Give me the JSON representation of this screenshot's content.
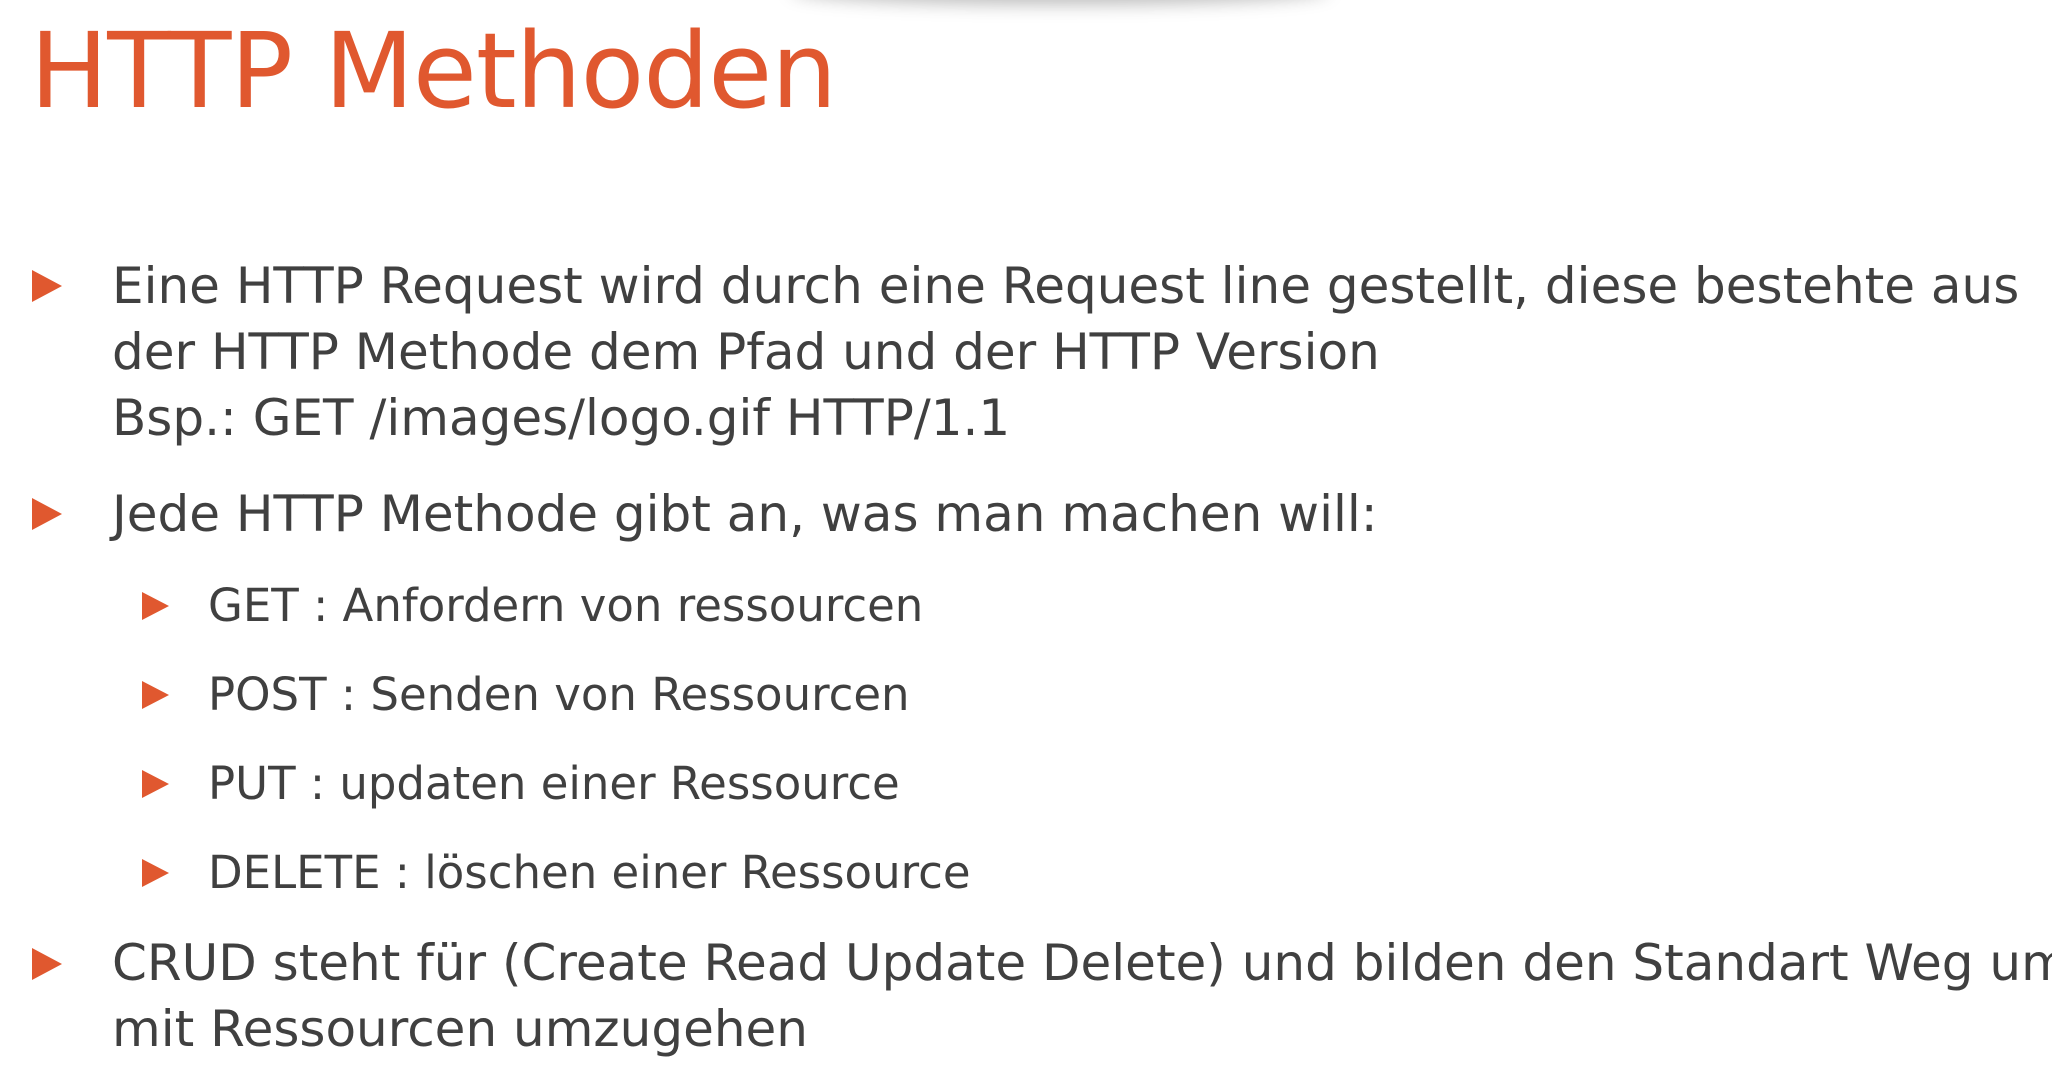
{
  "slide": {
    "title": "HTTP Methoden",
    "accent_color": "#e0582f",
    "text_color": "#404040",
    "bullet_marker_icon": "triangle-right-icon",
    "bullets": [
      {
        "lines": [
          "Eine HTTP Request wird durch eine Request line gestellt, diese bestehte aus",
          "der HTTP Methode dem Pfad und der HTTP Version",
          "Bsp.: GET /images/logo.gif HTTP/1.1"
        ]
      },
      {
        "lines": [
          "Jede HTTP Methode gibt an, was man machen will:"
        ],
        "sub_items": [
          "GET : Anfordern von ressourcen",
          "POST : Senden von Ressourcen",
          "PUT : updaten einer Ressource",
          "DELETE : löschen einer Ressource"
        ]
      },
      {
        "lines": [
          "CRUD steht für (Create Read Update Delete) und bilden den Standart Weg um",
          "mit Ressourcen umzugehen"
        ]
      }
    ]
  }
}
